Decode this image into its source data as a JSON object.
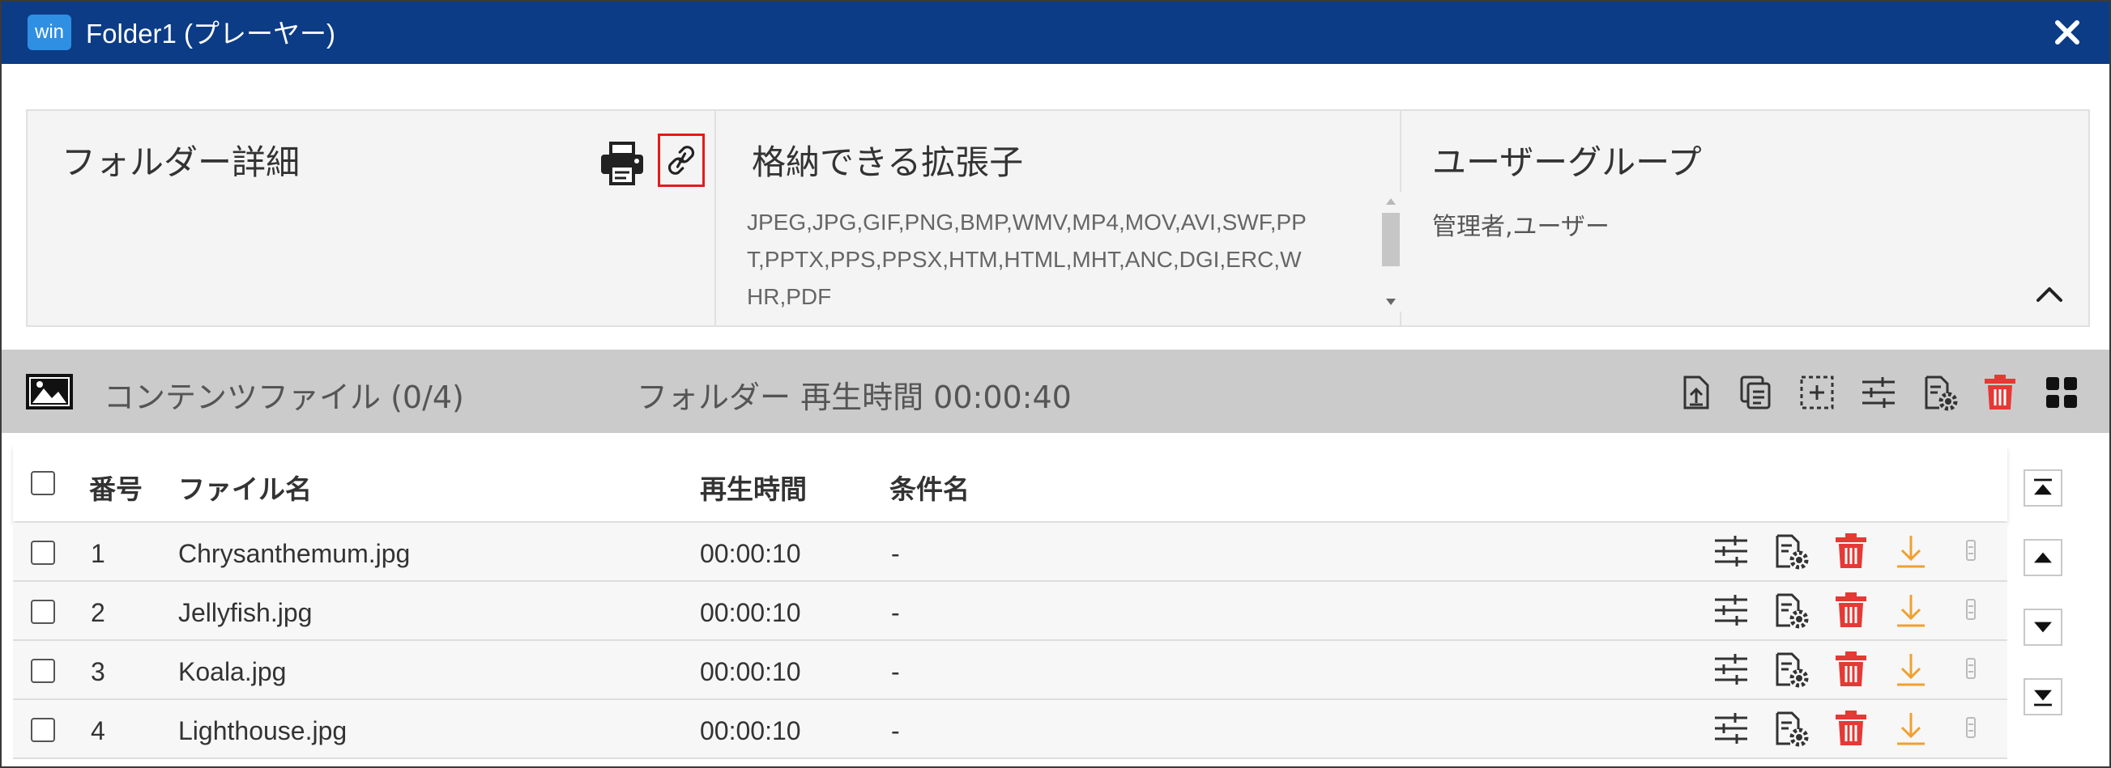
{
  "window": {
    "logo_text": "win",
    "title": "Folder1 (プレーヤー)"
  },
  "info": {
    "folder_detail_heading": "フォルダー詳細",
    "extensions_heading": "格納できる拡張子",
    "extensions_text": "JPEG,JPG,GIF,PNG,BMP,WMV,MP4,MOV,AVI,SWF,PPT,PPTX,PPS,PPSX,HTM,HTML,MHT,ANC,DGI,ERC,WHR,PDF",
    "user_group_heading": "ユーザーグループ",
    "user_group_value": "管理者,ユーザー"
  },
  "contents": {
    "title": "コンテンツファイル (0/4)",
    "folder_play_time": "フォルダー 再生時間 00:00:40"
  },
  "table": {
    "headers": {
      "number": "番号",
      "filename": "ファイル名",
      "play_time": "再生時間",
      "condition": "条件名"
    },
    "rows": [
      {
        "number": "1",
        "filename": "Chrysanthemum.jpg",
        "play_time": "00:00:10",
        "condition": "-"
      },
      {
        "number": "2",
        "filename": "Jellyfish.jpg",
        "play_time": "00:00:10",
        "condition": "-"
      },
      {
        "number": "3",
        "filename": "Koala.jpg",
        "play_time": "00:00:10",
        "condition": "-"
      },
      {
        "number": "4",
        "filename": "Lighthouse.jpg",
        "play_time": "00:00:10",
        "condition": "-"
      }
    ]
  },
  "colors": {
    "titlebar": "#0c3c86",
    "logo": "#2e8fe3",
    "highlight": "#e21b1b",
    "delete": "#e53935",
    "download": "#f0a030"
  }
}
